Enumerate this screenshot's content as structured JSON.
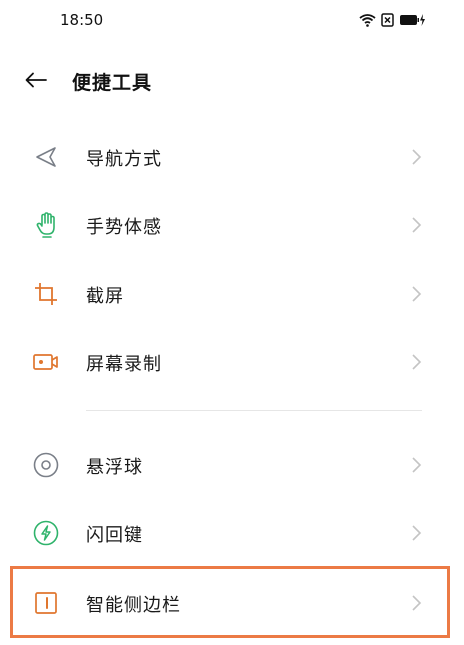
{
  "status_bar": {
    "time": "18:50",
    "icons": [
      "wifi-icon",
      "sim-x-icon",
      "battery-charging-icon"
    ]
  },
  "header": {
    "back_icon": "arrow-left-icon",
    "title": "便捷工具"
  },
  "menu": {
    "items": [
      {
        "label": "导航方式",
        "icon": "navigation-icon"
      },
      {
        "label": "手势体感",
        "icon": "hand-gesture-icon"
      },
      {
        "label": "截屏",
        "icon": "crop-icon"
      },
      {
        "label": "屏幕录制",
        "icon": "screen-record-icon"
      },
      {
        "label": "悬浮球",
        "icon": "floating-ball-icon"
      },
      {
        "label": "闪回键",
        "icon": "flashback-icon"
      },
      {
        "label": "智能侧边栏",
        "icon": "smart-sidebar-icon"
      }
    ]
  },
  "colors": {
    "accent_green": "#2fb36b",
    "accent_orange": "#e0762e",
    "icon_gray": "#7a7f88",
    "highlight": "#ec7a45"
  }
}
